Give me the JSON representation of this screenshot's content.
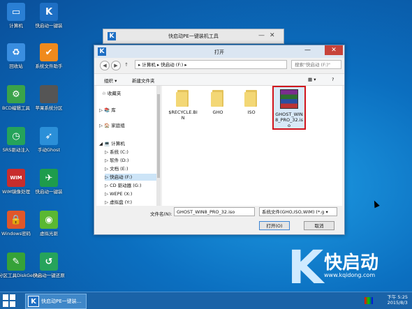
{
  "desktop": {
    "icons": [
      {
        "label": "计算机",
        "icon": "computer-icon",
        "color": "#2a7fd4"
      },
      {
        "label": "快启动一键装",
        "icon": "k-logo-icon",
        "color": "#1e6fc4"
      },
      {
        "label": "回收站",
        "icon": "recycle-bin-icon",
        "color": "#3a8ee0"
      },
      {
        "label": "系统文件助手",
        "icon": "shield-icon",
        "color": "#f08a1c"
      },
      {
        "label": "BCD编辑工具",
        "icon": "gear-icon",
        "color": "#3aa34a"
      },
      {
        "label": "苹果系统分区",
        "icon": "apple-icon",
        "color": "#555555"
      },
      {
        "label": "SRS驱动注入",
        "icon": "clock-icon",
        "color": "#25a35a"
      },
      {
        "label": "手动Ghost",
        "icon": "bird-icon",
        "color": "#2b8fd8"
      },
      {
        "label": "WIM镜像处理",
        "icon": "wim-icon",
        "color": "#c82d2d"
      },
      {
        "label": "快启动一键装",
        "icon": "runner-icon",
        "color": "#1e9c4c"
      },
      {
        "label": "Windows密码",
        "icon": "lock-icon",
        "color": "#e0572a"
      },
      {
        "label": "虚拟光驱",
        "icon": "disc-icon",
        "color": "#5ab832"
      },
      {
        "label": "分区工具DiskGenius",
        "icon": "wrench-icon",
        "color": "#36a238"
      },
      {
        "label": "快启动一键还原",
        "icon": "restore-icon",
        "color": "#26a35c"
      }
    ]
  },
  "bg_window": {
    "title": "快启动PE一键装机工具"
  },
  "dialog": {
    "title": "打开",
    "address": "▸ 计算机 ▸ 快启动 (F:) ▸",
    "search_placeholder": "搜索\"快启动 (F:)\"",
    "toolbar": {
      "organize": "组织 ▾",
      "new_folder": "新建文件夹"
    },
    "nav": [
      {
        "label": "☆ 收藏夹",
        "indent": 8
      },
      {
        "label": "▷ 📚 库",
        "indent": 4
      },
      {
        "label": "▷ 🏠 家庭组",
        "indent": 4
      },
      {
        "label": "◢ 💻 计算机",
        "indent": 4
      },
      {
        "label": "▷ 系统 (C:)",
        "indent": 12
      },
      {
        "label": "▷ 软件 (D:)",
        "indent": 12
      },
      {
        "label": "▷ 文档 (E:)",
        "indent": 12
      },
      {
        "label": "▷ 快启动 (F:)",
        "indent": 12
      },
      {
        "label": "▷ CD 驱动器 (G:)",
        "indent": 12
      },
      {
        "label": "▷ WEPE (X:)",
        "indent": 12
      },
      {
        "label": "▷ 虚拟盘 (Y:)",
        "indent": 12
      }
    ],
    "files": [
      {
        "name": "$RECYCLE.BIN",
        "type": "folder"
      },
      {
        "name": "GHO",
        "type": "folder"
      },
      {
        "name": "ISO",
        "type": "folder"
      },
      {
        "name": "GHOST_WIN8_PRO_32.iso",
        "type": "iso"
      }
    ],
    "filename_label": "文件名(N):",
    "filename_value": "GHOST_WIN8_PRO_32.iso",
    "filetype_value": "系统文件(GHO,ISO,WIM) (*.g ▾",
    "open_btn": "打开(O)",
    "cancel_btn": "取消"
  },
  "taskbar": {
    "task_label": "快启动PE一键装…",
    "time": "下午 5:25",
    "date": "2015/8/3"
  },
  "brand": {
    "name": "快启动",
    "url": "www.kqidong.com"
  }
}
